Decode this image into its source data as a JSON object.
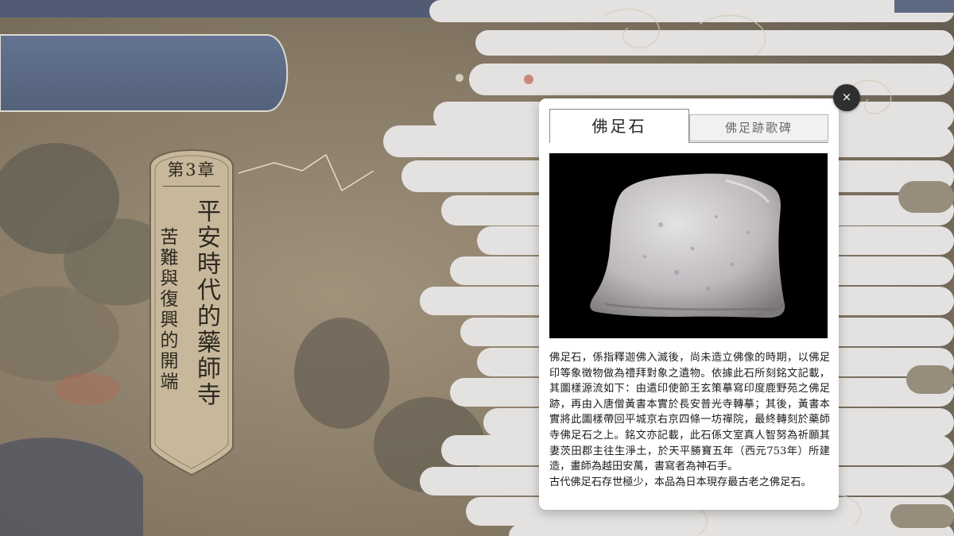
{
  "chapter": {
    "number_label": "第3章",
    "title": "平安時代的藥師寺",
    "subtitle": "苦難與復興的開端"
  },
  "modal": {
    "tabs": [
      {
        "label": "佛足石",
        "active": true
      },
      {
        "label": "佛足跡歌碑",
        "active": false
      }
    ],
    "image_subject": "stone",
    "description": [
      "佛足石，係指釋迦佛入滅後，尚未造立佛像的時期，以佛足印等象徵物做為禮拜對象之遺物。依據此石所刻銘文記載，其圖樣源流如下：由遣印使節王玄策摹寫印度鹿野苑之佛足跡，再由入唐僧黃書本實於長安普光寺轉摹；其後，黃書本實將此圖樣帶回平城京右京四條一坊禪院，最終轉刻於藥師寺佛足石之上。銘文亦記載，此石係文室真人智努為祈願其妻茨田郡主往生淨土，於天平勝寶五年（西元753年）所建造，畫師為越田安萬，書寫者為神石手。",
      "古代佛足石存世極少，本品為日本現存最古老之佛足石。"
    ],
    "close_icon": "×"
  },
  "colors": {
    "banner_fill": "#c7b89c",
    "banner_border": "#6e6550",
    "cloud": "#dedcda",
    "sky": "#3b4d6e",
    "modal_bg": "#ffffff",
    "close_bg": "#2f2f2f"
  }
}
